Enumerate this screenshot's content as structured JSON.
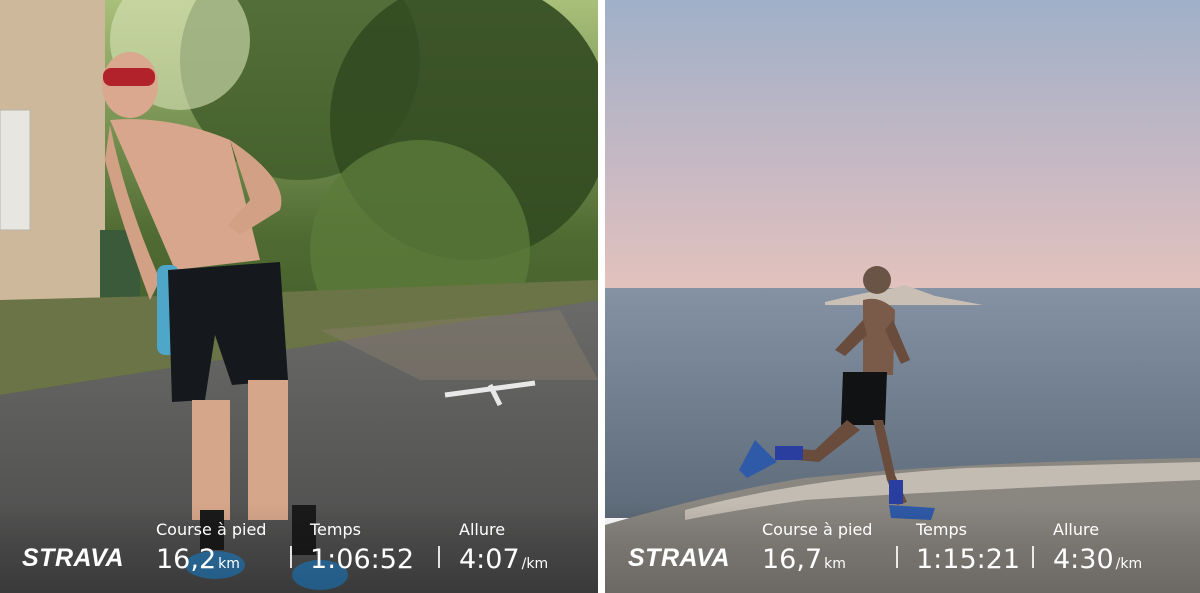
{
  "activities": [
    {
      "brand": "STRAVA",
      "distance_label": "Course à pied",
      "distance_value": "16,2",
      "distance_unit": "km",
      "time_label": "Temps",
      "time_value": "1:06:52",
      "pace_label": "Allure",
      "pace_value": "4:07",
      "pace_unit": "/km"
    },
    {
      "brand": "STRAVA",
      "distance_label": "Course à pied",
      "distance_value": "16,7",
      "distance_unit": "km",
      "time_label": "Temps",
      "time_value": "1:15:21",
      "pace_label": "Allure",
      "pace_value": "4:30",
      "pace_unit": "/km"
    }
  ]
}
